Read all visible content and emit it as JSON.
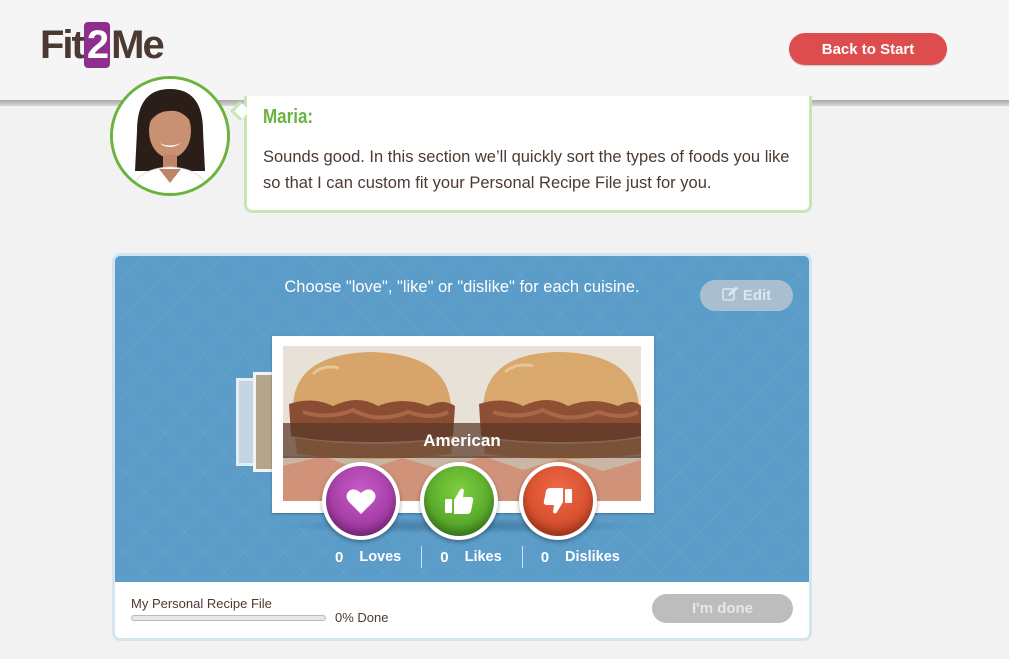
{
  "header": {
    "logo": {
      "part1": "Fit",
      "part2": "2",
      "part3": "Me"
    },
    "back_button": "Back to Start"
  },
  "coach": {
    "name": "Maria:",
    "message": "Sounds good. In this section we’ll quickly sort the types of foods you like so that I can custom fit your Personal Recipe File just for you."
  },
  "sorter": {
    "instruction": "Choose \"love\", \"like\" or \"dislike\" for each cuisine.",
    "edit_button": "Edit",
    "current_cuisine": "American",
    "counts": [
      {
        "value": "0",
        "label": "Loves"
      },
      {
        "value": "0",
        "label": "Likes"
      },
      {
        "value": "0",
        "label": "Dislikes"
      }
    ]
  },
  "footer": {
    "file_label": "My Personal Recipe File",
    "progress_fraction": 0,
    "progress_text": "0% Done",
    "done_button": "I'm done"
  },
  "colors": {
    "brand_purple": "#8e2f8e",
    "accent_green": "#6ab33f",
    "back_red": "#dd4d4d",
    "panel_blue": "#5b9cc9",
    "dislike_orange": "#e3502c"
  },
  "icons": [
    "heart-icon",
    "thumbs-up-icon",
    "thumbs-down-icon",
    "edit-icon"
  ]
}
